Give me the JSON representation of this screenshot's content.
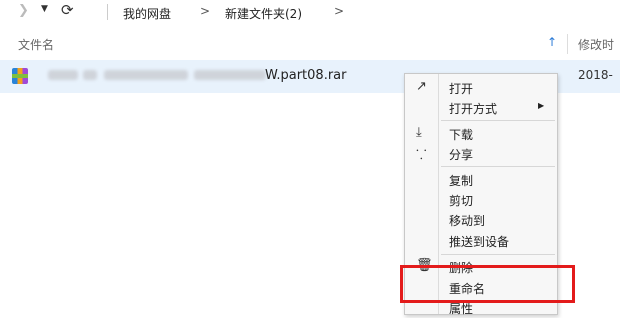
{
  "toolbar": {
    "back_icon": "chevron-right-icon",
    "dropdown_icon": "triangle-down-icon",
    "refresh_icon": "refresh-icon"
  },
  "breadcrumb": {
    "root": "我的网盘",
    "separator": ">",
    "folder": "新建文件夹(2)"
  },
  "columns": {
    "name": "文件名",
    "modified": "修改时"
  },
  "file": {
    "name_visible_suffix": "W.part08.rar",
    "date": "2018-",
    "icon": "rar-archive-icon"
  },
  "context_menu": {
    "items": [
      {
        "label": "打开",
        "icon": "open-arrow-icon"
      },
      {
        "label": "打开方式",
        "submenu": true
      },
      {
        "label": "下载",
        "icon": "download-icon"
      },
      {
        "label": "分享",
        "icon": "share-icon"
      },
      {
        "label": "复制"
      },
      {
        "label": "剪切"
      },
      {
        "label": "移动到"
      },
      {
        "label": "推送到设备"
      },
      {
        "label": "删除",
        "icon": "trash-icon"
      },
      {
        "label": "重命名"
      },
      {
        "label": "属性"
      }
    ]
  },
  "highlight_color": "#e31b1b",
  "selection_color": "#e8f2fc"
}
